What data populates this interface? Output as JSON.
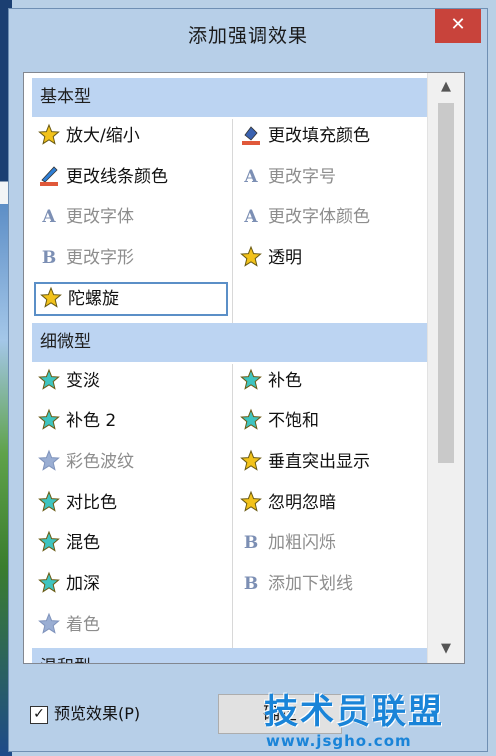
{
  "window": {
    "title": "添加强调效果",
    "close_glyph": "✕"
  },
  "sections": [
    {
      "header": "基本型",
      "left": [
        {
          "label": "放大/缩小",
          "icon": "star-resize-icon",
          "disabled": false
        },
        {
          "label": "更改线条颜色",
          "icon": "pen-rainbow-icon",
          "disabled": false
        },
        {
          "label": "更改字体",
          "icon": "letter-a-icon",
          "disabled": true
        },
        {
          "label": "更改字形",
          "icon": "letter-b-icon",
          "disabled": true
        },
        {
          "label": "陀螺旋",
          "icon": "star-spin-icon",
          "disabled": false,
          "selected": true
        }
      ],
      "right": [
        {
          "label": "更改填充颜色",
          "icon": "paint-bucket-icon",
          "disabled": false
        },
        {
          "label": "更改字号",
          "icon": "letter-a-plus-icon",
          "disabled": true
        },
        {
          "label": "更改字体颜色",
          "icon": "letter-a-color-icon",
          "disabled": true
        },
        {
          "label": "透明",
          "icon": "star-transparent-icon",
          "disabled": false
        }
      ]
    },
    {
      "header": "细微型",
      "left": [
        {
          "label": "变淡",
          "icon": "stars-fade-icon",
          "disabled": false
        },
        {
          "label": "补色 2",
          "icon": "stars-complement-icon",
          "disabled": false
        },
        {
          "label": "彩色波纹",
          "icon": "stars-wave-icon",
          "disabled": true
        },
        {
          "label": "对比色",
          "icon": "stars-contrast-icon",
          "disabled": false
        },
        {
          "label": "混色",
          "icon": "stars-blend-icon",
          "disabled": false
        },
        {
          "label": "加深",
          "icon": "stars-darken-icon",
          "disabled": false
        },
        {
          "label": "着色",
          "icon": "stars-tint-icon",
          "disabled": true
        }
      ],
      "right": [
        {
          "label": "补色",
          "icon": "stars-complement-icon",
          "disabled": false
        },
        {
          "label": "不饱和",
          "icon": "stars-desaturate-icon",
          "disabled": false
        },
        {
          "label": "垂直突出显示",
          "icon": "star-highlight-icon",
          "disabled": false
        },
        {
          "label": "忽明忽暗",
          "icon": "star-flicker-icon",
          "disabled": false
        },
        {
          "label": "加粗闪烁",
          "icon": "letter-b-flash-icon",
          "disabled": true
        },
        {
          "label": "添加下划线",
          "icon": "letter-b-underline-icon",
          "disabled": true
        }
      ]
    },
    {
      "header": "温和型",
      "left": [],
      "right": []
    }
  ],
  "scrollbar": {
    "up_glyph": "▲",
    "down_glyph": "▼"
  },
  "footer": {
    "preview_label": "预览效果(P)",
    "preview_checked": true,
    "check_glyph": "✓",
    "ok_label": "确定"
  },
  "watermark": {
    "main": "技术员联盟",
    "url": "www.jsgho.com"
  },
  "colors": {
    "header_bg": "#bcd4f2",
    "selection_border": "#5b8fc7",
    "close_bg": "#c8433b",
    "watermark": "#1a84d8",
    "disabled_text": "#8d8d8d"
  }
}
